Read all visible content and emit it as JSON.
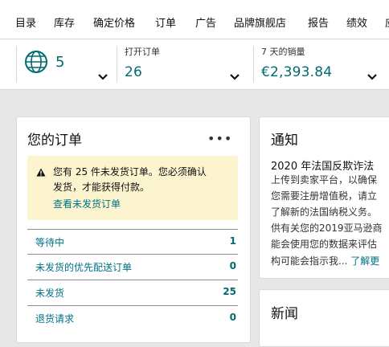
{
  "nav": {
    "items": [
      "目录",
      "库存",
      "确定价格",
      "订单",
      "广告",
      "品牌旗舰店",
      "报告",
      "绩效",
      "应"
    ]
  },
  "metrics": {
    "marketplaces_count": "5",
    "open_orders": {
      "label": "打开订单",
      "value": "26"
    },
    "sales_7d": {
      "label": "7 天的销量",
      "value": "€2,393.84"
    }
  },
  "orders_card": {
    "title": "您的订单",
    "more": "•••",
    "alert": {
      "line1": "您有 25 件未发货订单。您必须确认",
      "line2": "发货，才能获得付款。",
      "link": "查看未发货订单"
    },
    "rows": [
      {
        "label": "等待中",
        "count": "1"
      },
      {
        "label": "未发货的优先配送订单",
        "count": "0"
      },
      {
        "label": "未发货",
        "count": "25"
      },
      {
        "label": "退货请求",
        "count": "0"
      }
    ]
  },
  "notice_card": {
    "title": "通知",
    "headline": "2020 年法国反欺诈法",
    "lines": [
      "上传到卖家平台，以确保",
      "您需要注册增值税，请立",
      "了解新的法国纳税义务。",
      "供有关您的2019亚马逊商",
      "能会使用您的数据来评估"
    ],
    "last_line": "构可能会指示我...",
    "more_link": "了解更"
  },
  "news_card": {
    "title": "新闻"
  },
  "colors": {
    "accent": "#006b70",
    "link": "#007185",
    "alert_bg": "#fcf4cf"
  },
  "icons": [
    "globe-icon",
    "chevron-down-icon",
    "warning-icon",
    "more-options-icon"
  ]
}
